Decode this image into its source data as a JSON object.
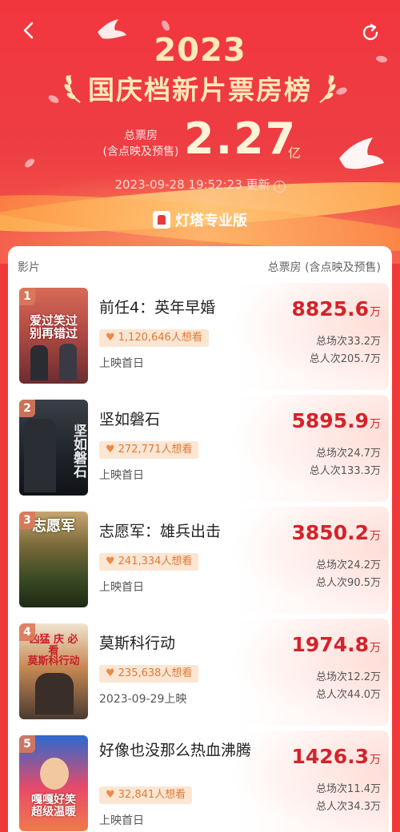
{
  "header": {
    "year": "2023",
    "title": "国庆档新片票房榜",
    "total_label_line1": "总票房",
    "total_label_line2": "(含点映及预售)",
    "total_value": "2.27",
    "total_unit": "亿",
    "updated": "2023-09-28 19:52:23 更新",
    "brand": "灯塔专业版",
    "back_icon": "chevron-left-icon",
    "refresh_icon": "refresh-icon"
  },
  "table": {
    "col_film": "影片",
    "col_box": "总票房 (含点映及预售)"
  },
  "movies": [
    {
      "rank": "1",
      "title": "前任4：英年早婚",
      "want": "1,120,646人想看",
      "release": "上映首日",
      "box": "8825.6",
      "box_unit": "万",
      "shows": "总场次33.2万",
      "viewers": "总人次205.7万",
      "poster_text": "爱过笑过\n别再错过"
    },
    {
      "rank": "2",
      "title": "坚如磐石",
      "want": "272,771人想看",
      "release": "上映首日",
      "box": "5895.9",
      "box_unit": "万",
      "shows": "总场次24.7万",
      "viewers": "总人次133.3万",
      "poster_text": "坚如磐石"
    },
    {
      "rank": "3",
      "title": "志愿军：雄兵出击",
      "want": "241,334人想看",
      "release": "上映首日",
      "box": "3850.2",
      "box_unit": "万",
      "shows": "总场次24.2万",
      "viewers": "总人次90.5万",
      "poster_text": "志愿军"
    },
    {
      "rank": "4",
      "title": "莫斯科行动",
      "want": "235,638人想看",
      "release": "2023-09-29上映",
      "box": "1974.8",
      "box_unit": "万",
      "shows": "总场次12.2万",
      "viewers": "总人次44.0万",
      "poster_text": "凶猛 庆 必看\n莫斯科行动"
    },
    {
      "rank": "5",
      "title": "好像也没那么热血沸腾",
      "want": "32,841人想看",
      "release": "上映首日",
      "box": "1426.3",
      "box_unit": "万",
      "shows": "总场次11.4万",
      "viewers": "总人次34.3万",
      "poster_text": "嘎嘎好笑 超级温暖"
    }
  ]
}
